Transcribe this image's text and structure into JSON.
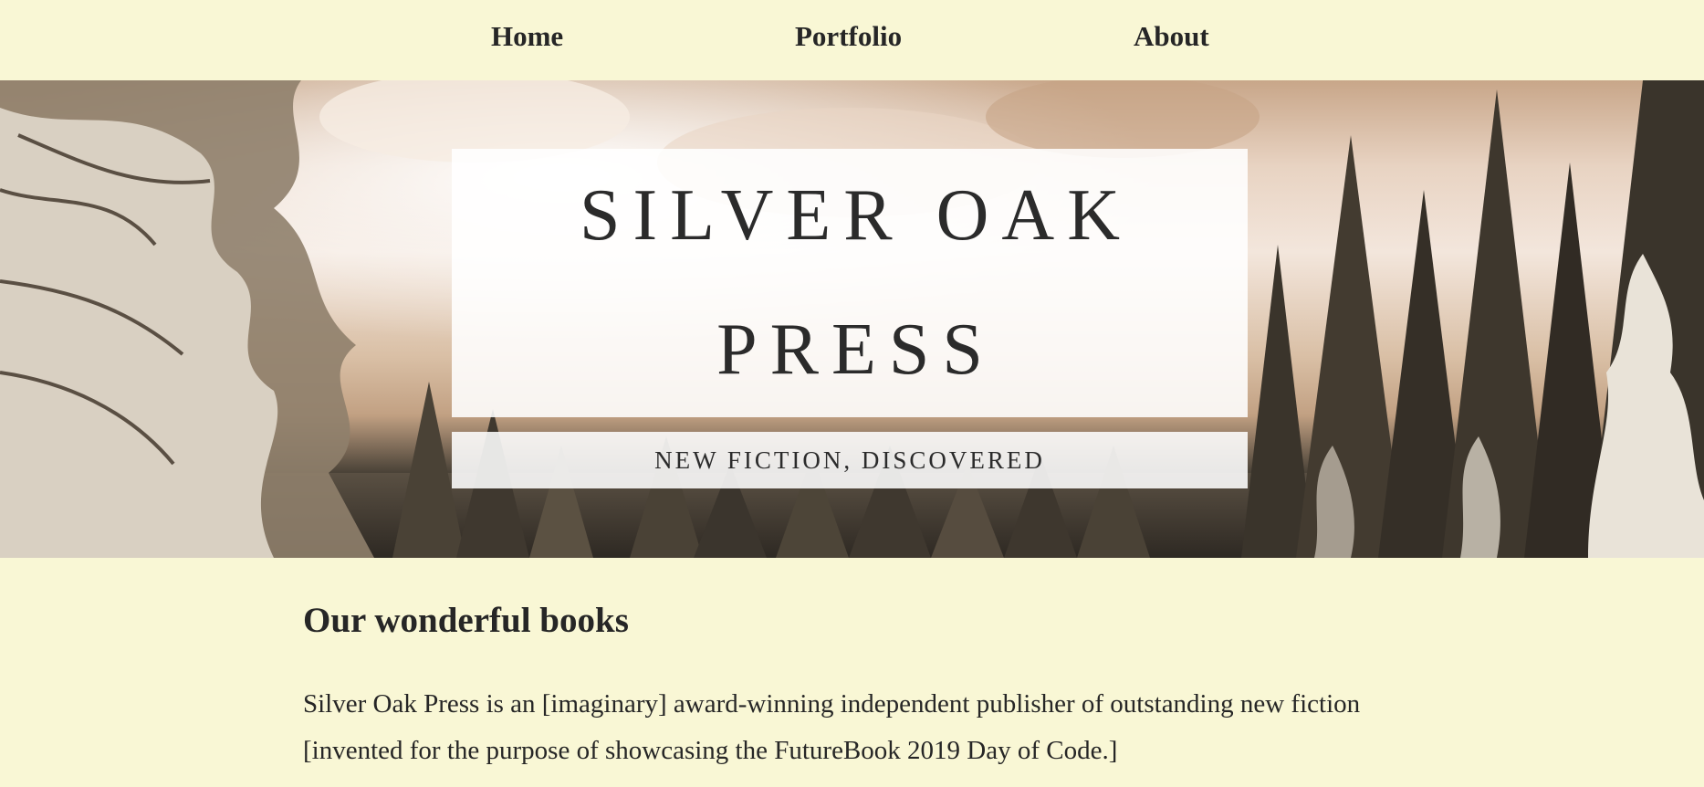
{
  "nav": {
    "items": [
      {
        "label": "Home"
      },
      {
        "label": "Portfolio"
      },
      {
        "label": "About"
      }
    ]
  },
  "hero": {
    "title_line1": "SILVER OAK",
    "title_line2": "PRESS",
    "tagline": "NEW FICTION, DISCOVERED",
    "background": "snowy-forest-image"
  },
  "content": {
    "heading": "Our wonderful books",
    "paragraph": "Silver Oak Press is an [imaginary] award-winning independent publisher of outstanding new fiction [invented for the purpose of showcasing the FutureBook 2019 Day of Code.]"
  },
  "colors": {
    "page_background": "#f9f7d5",
    "text": "#262626",
    "overlay": "#ffffff"
  }
}
